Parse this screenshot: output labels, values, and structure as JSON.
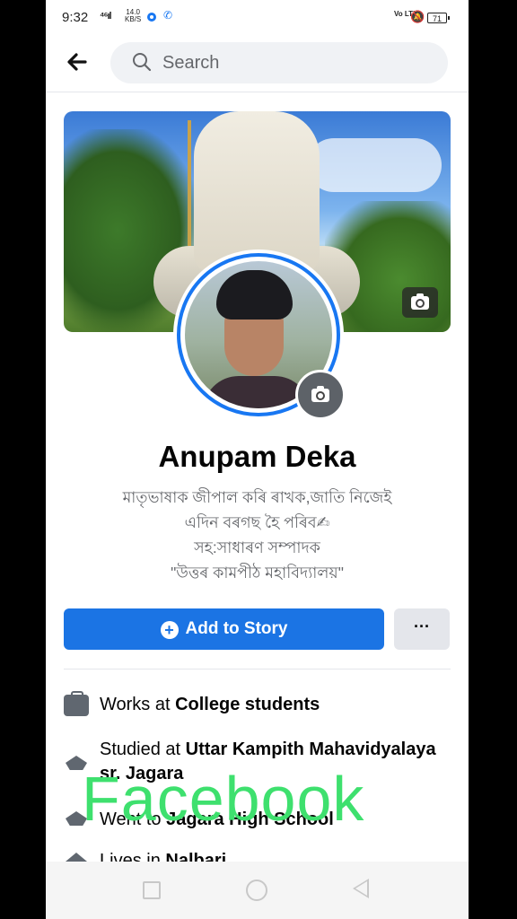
{
  "status_bar": {
    "time": "9:32",
    "signal": "⁴⁶ıl",
    "speed_value": "14.0",
    "speed_unit": "KB/S",
    "volte": "Vo LTE",
    "battery": "71"
  },
  "search": {
    "placeholder": "Search"
  },
  "profile": {
    "name": "Anupam Deka",
    "bio": [
      "মাতৃভাষাক জীপাল কৰি ৰাখক,জাতি নিজেই",
      "এদিন বৰগছ হৈ পৰিব✍",
      "সহ:সাধাৰণ সম্পাদক",
      "\"উত্তৰ কামপীঠ মহাবিদ্যালয়\""
    ]
  },
  "actions": {
    "add_story": "Add to Story",
    "more": "···"
  },
  "details": [
    {
      "icon": "briefcase-icon",
      "prefix": "Works at ",
      "bold": "College students"
    },
    {
      "icon": "graduation-cap-icon",
      "prefix": "Studied at ",
      "bold": "Uttar Kampith Mahavidyalaya sr. Jagara"
    },
    {
      "icon": "graduation-cap-icon",
      "prefix": "Went to ",
      "bold": "Jagara High School"
    },
    {
      "icon": "home-icon",
      "prefix": "Lives in ",
      "bold": "Nalbari"
    }
  ],
  "watermark": "Facebook",
  "colors": {
    "accent": "#1b74e4",
    "watermark": "#3ee06e"
  }
}
